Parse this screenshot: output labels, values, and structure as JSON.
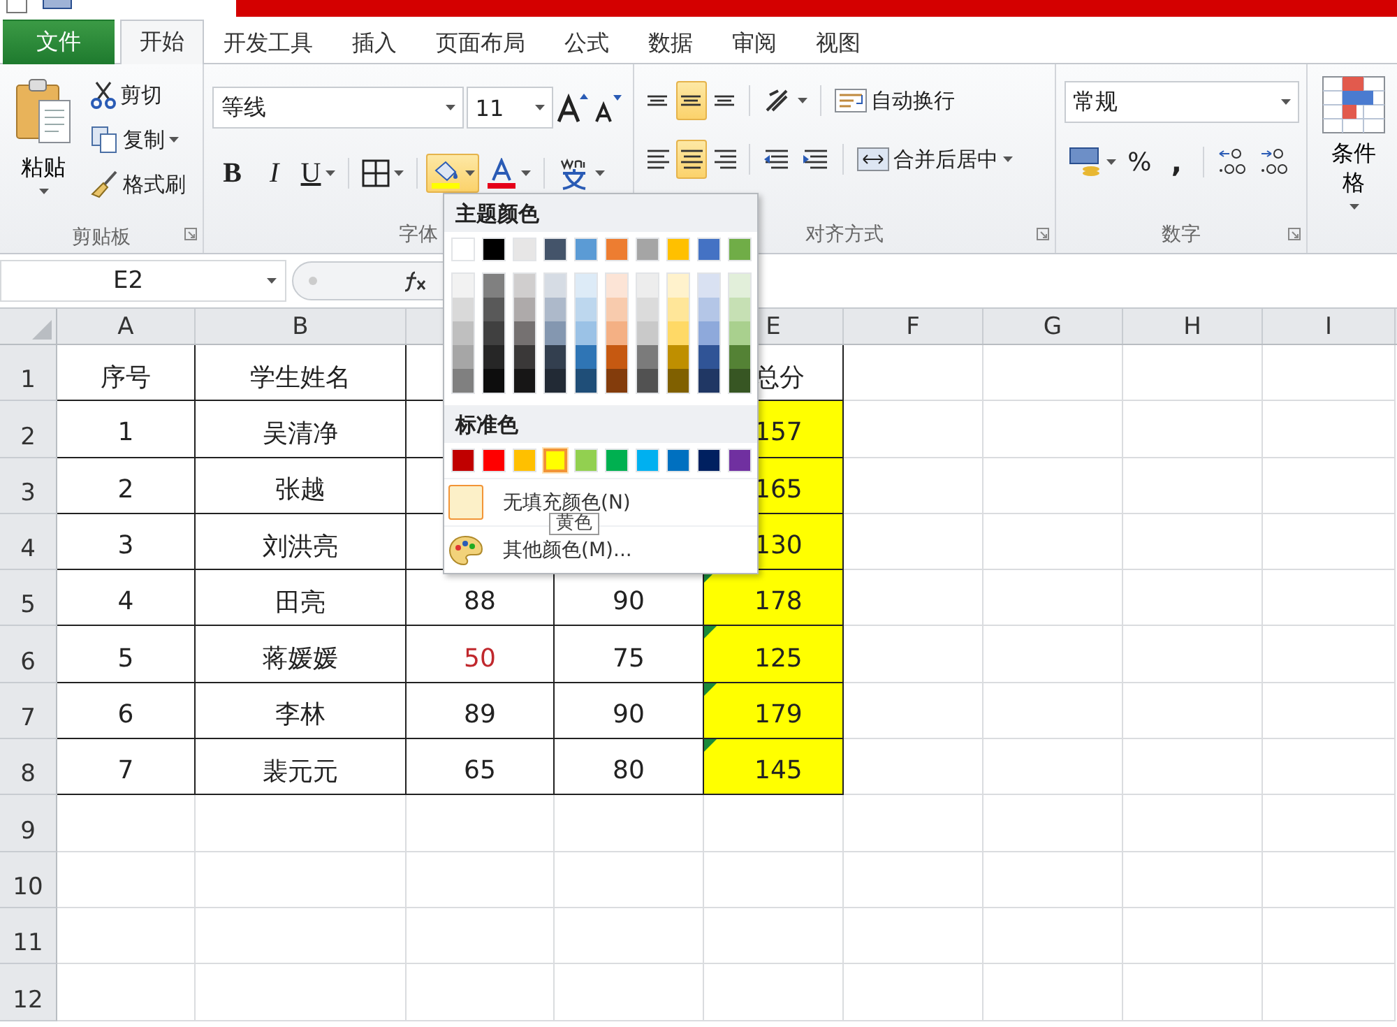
{
  "tabs": [
    {
      "label": "文件",
      "kind": "file",
      "selected": false
    },
    {
      "label": "开始",
      "kind": "tab",
      "selected": true
    },
    {
      "label": "开发工具",
      "kind": "tab",
      "selected": false
    },
    {
      "label": "插入",
      "kind": "tab",
      "selected": false
    },
    {
      "label": "页面布局",
      "kind": "tab",
      "selected": false
    },
    {
      "label": "公式",
      "kind": "tab",
      "selected": false
    },
    {
      "label": "数据",
      "kind": "tab",
      "selected": false
    },
    {
      "label": "审阅",
      "kind": "tab",
      "selected": false
    },
    {
      "label": "视图",
      "kind": "tab",
      "selected": false
    }
  ],
  "clipboard": {
    "label": "剪贴板",
    "paste": "粘贴",
    "cut": "剪切",
    "copy": "复制",
    "format_painter": "格式刷"
  },
  "font": {
    "label": "字体",
    "font_name": "等线",
    "font_size": "11",
    "bold": "B",
    "italic": "I",
    "underline": "U",
    "fill_expanded": true
  },
  "alignment": {
    "label": "对齐方式",
    "middle_align_selected": true,
    "center_selected": true,
    "wrap_text": "自动换行",
    "merge_center": "合并后居中"
  },
  "number": {
    "label": "数字",
    "format": "常规",
    "percent": "%",
    "comma": ","
  },
  "styles": {
    "conditional_format": "条件格"
  },
  "formula_bar": {
    "name_box": "E2"
  },
  "columns": [
    {
      "label": "A"
    },
    {
      "label": "B"
    },
    {},
    {},
    {
      "label": "E"
    },
    {
      "label": "F"
    },
    {
      "label": "G"
    },
    {
      "label": "H"
    },
    {
      "label": "I"
    }
  ],
  "rows": [
    {
      "header": "1",
      "a": {
        "text": "序号"
      },
      "b": {
        "text": "学生姓名"
      },
      "e": {
        "text": "总分",
        "filled": false,
        "error_mark": false
      }
    },
    {
      "header": "2",
      "a": {
        "text": "1"
      },
      "b": {
        "text": "吴清净"
      },
      "e": {
        "text": "157",
        "filled": true,
        "error_mark": false
      }
    },
    {
      "header": "3",
      "a": {
        "text": "2"
      },
      "b": {
        "text": "张越"
      },
      "e": {
        "text": "165",
        "filled": true,
        "error_mark": false
      }
    },
    {
      "header": "4",
      "a": {
        "text": "3"
      },
      "b": {
        "text": "刘洪亮"
      },
      "e": {
        "text": "130",
        "filled": true,
        "error_mark": false
      }
    },
    {
      "header": "5",
      "a": {
        "text": "4"
      },
      "b": {
        "text": "田亮"
      },
      "c": {
        "text": "88",
        "flagged": false
      },
      "d": {
        "text": "90"
      },
      "e": {
        "text": "178",
        "filled": true,
        "error_mark": true
      }
    },
    {
      "header": "6",
      "a": {
        "text": "5"
      },
      "b": {
        "text": "蒋媛媛"
      },
      "c": {
        "text": "50",
        "flagged": true
      },
      "d": {
        "text": "75"
      },
      "e": {
        "text": "125",
        "filled": true,
        "error_mark": true
      }
    },
    {
      "header": "7",
      "a": {
        "text": "6"
      },
      "b": {
        "text": "李林"
      },
      "c": {
        "text": "89",
        "flagged": false
      },
      "d": {
        "text": "90"
      },
      "e": {
        "text": "179",
        "filled": true,
        "error_mark": true
      }
    },
    {
      "header": "8",
      "a": {
        "text": "7"
      },
      "b": {
        "text": "裴元元"
      },
      "c": {
        "text": "65",
        "flagged": false
      },
      "d": {
        "text": "80"
      },
      "e": {
        "text": "145",
        "filled": true,
        "error_mark": true
      }
    },
    {
      "header": "9"
    },
    {
      "header": "10"
    },
    {
      "header": "11"
    },
    {
      "header": "12"
    }
  ],
  "fill_menu": {
    "theme_title": "主题颜色",
    "theme_colors": [
      {
        "color": "#ffffff",
        "shades": [
          {
            "color": "#f2f2f2"
          },
          {
            "color": "#d9d9d9"
          },
          {
            "color": "#bfbfbf"
          },
          {
            "color": "#a6a6a6"
          },
          {
            "color": "#808080"
          }
        ]
      },
      {
        "color": "#000000",
        "shades": [
          {
            "color": "#808080"
          },
          {
            "color": "#595959"
          },
          {
            "color": "#404040"
          },
          {
            "color": "#262626"
          },
          {
            "color": "#0d0d0d"
          }
        ]
      },
      {
        "color": "#e7e6e6",
        "shades": [
          {
            "color": "#d0cece"
          },
          {
            "color": "#aeaaaa"
          },
          {
            "color": "#757171"
          },
          {
            "color": "#3a3838"
          },
          {
            "color": "#171616"
          }
        ]
      },
      {
        "color": "#44546a",
        "shades": [
          {
            "color": "#d6dce4"
          },
          {
            "color": "#adb9ca"
          },
          {
            "color": "#8497b0"
          },
          {
            "color": "#333f4f"
          },
          {
            "color": "#222a35"
          }
        ]
      },
      {
        "color": "#5b9bd5",
        "shades": [
          {
            "color": "#ddebf7"
          },
          {
            "color": "#bdd7ee"
          },
          {
            "color": "#9bc2e6"
          },
          {
            "color": "#2f75b5"
          },
          {
            "color": "#1f4e78"
          }
        ]
      },
      {
        "color": "#ed7d31",
        "shades": [
          {
            "color": "#fce4d6"
          },
          {
            "color": "#f8cbad"
          },
          {
            "color": "#f4b084"
          },
          {
            "color": "#c65911"
          },
          {
            "color": "#833c0c"
          }
        ]
      },
      {
        "color": "#a5a5a5",
        "shades": [
          {
            "color": "#ededed"
          },
          {
            "color": "#dbdbdb"
          },
          {
            "color": "#c9c9c9"
          },
          {
            "color": "#7b7b7b"
          },
          {
            "color": "#525252"
          }
        ]
      },
      {
        "color": "#ffc000",
        "shades": [
          {
            "color": "#fff2cc"
          },
          {
            "color": "#ffe699"
          },
          {
            "color": "#ffd966"
          },
          {
            "color": "#bf8f00"
          },
          {
            "color": "#806000"
          }
        ]
      },
      {
        "color": "#4472c4",
        "shades": [
          {
            "color": "#d9e1f2"
          },
          {
            "color": "#b4c6e7"
          },
          {
            "color": "#8ea9db"
          },
          {
            "color": "#305496"
          },
          {
            "color": "#203764"
          }
        ]
      },
      {
        "color": "#70ad47",
        "shades": [
          {
            "color": "#e2efda"
          },
          {
            "color": "#c6e0b4"
          },
          {
            "color": "#a9d08e"
          },
          {
            "color": "#548235"
          },
          {
            "color": "#375623"
          }
        ]
      }
    ],
    "standard_title": "标准色",
    "standard_colors": [
      {
        "color": "#c00000",
        "selected": false
      },
      {
        "color": "#ff0000",
        "selected": false
      },
      {
        "color": "#ffc000",
        "selected": false
      },
      {
        "color": "#ffff00",
        "selected": true
      },
      {
        "color": "#92d050",
        "selected": false
      },
      {
        "color": "#00b050",
        "selected": false
      },
      {
        "color": "#00b0f0",
        "selected": false
      },
      {
        "color": "#0070c0",
        "selected": false
      },
      {
        "color": "#002060",
        "selected": false
      },
      {
        "color": "#7030a0",
        "selected": false
      }
    ],
    "no_fill": "无填充颜色(N)",
    "more_colors": "其他颜色(M)...",
    "tooltip": "黄色"
  }
}
